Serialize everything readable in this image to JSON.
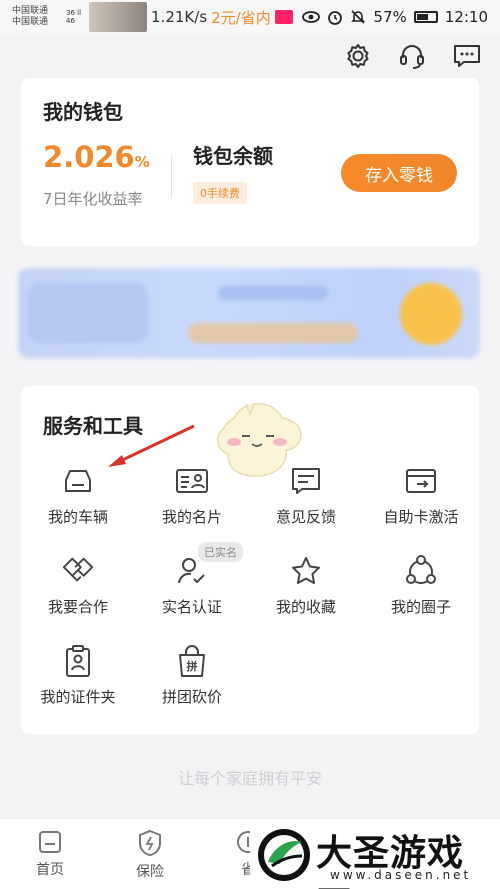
{
  "status_bar": {
    "carrier_1": "中国联通",
    "carrier_2": "中国联通",
    "signal_1": "36 ll",
    "signal_2": "46",
    "speed": "1.21K/s",
    "promo_text": "2元/省内",
    "battery": "57%",
    "time": "12:10"
  },
  "toolbar": {
    "icons": [
      "gear-icon",
      "headset-icon",
      "message-icon"
    ]
  },
  "wallet": {
    "title": "我的钱包",
    "rate_value": "2.026",
    "rate_unit": "%",
    "rate_label": "7日年化收益率",
    "balance_label": "钱包余额",
    "fee_badge": "0手续费",
    "deposit_button": "存入零钱"
  },
  "services": {
    "title": "服务和工具",
    "verified_badge": "已实名",
    "items": [
      {
        "label": "我的车辆",
        "icon": "car-icon"
      },
      {
        "label": "我的名片",
        "icon": "business-card-icon"
      },
      {
        "label": "意见反馈",
        "icon": "feedback-icon"
      },
      {
        "label": "自助卡激活",
        "icon": "card-activate-icon"
      },
      {
        "label": "我要合作",
        "icon": "handshake-icon"
      },
      {
        "label": "实名认证",
        "icon": "verify-user-icon"
      },
      {
        "label": "我的收藏",
        "icon": "star-icon"
      },
      {
        "label": "我的圈子",
        "icon": "circle-group-icon"
      },
      {
        "label": "我的证件夹",
        "icon": "id-folder-icon"
      },
      {
        "label": "拼团砍价",
        "icon": "group-buy-icon"
      }
    ]
  },
  "slogan": "让每个家庭拥有平安",
  "bottom_nav": [
    {
      "label": "首页",
      "icon": "home-icon"
    },
    {
      "label": "保险",
      "icon": "shield-icon"
    },
    {
      "label": "省",
      "icon": "save-icon"
    }
  ],
  "watermark": {
    "text": "大圣游戏网",
    "url": "www.daseen.net"
  },
  "colors": {
    "accent": "#f0892b",
    "background": "#f3f3f5",
    "card": "#ffffff",
    "arrow": "#d9332e"
  }
}
